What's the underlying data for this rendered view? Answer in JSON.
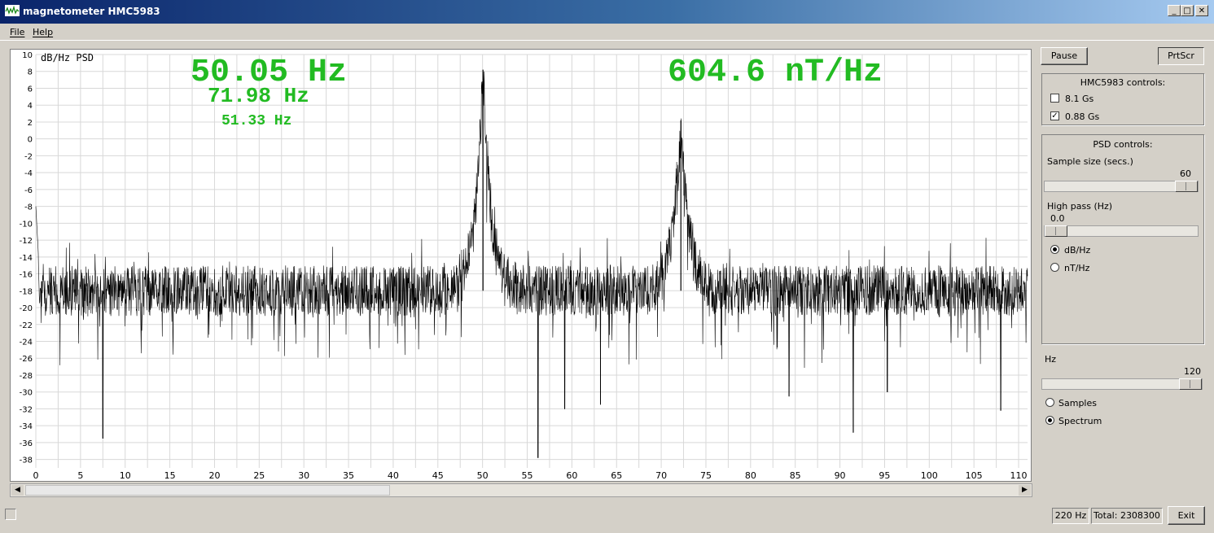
{
  "window": {
    "title": "magnetometer HMC5983",
    "min_glyph": "_",
    "max_glyph": "□",
    "close_glyph": "✕"
  },
  "menu": {
    "file": "File",
    "help": "Help"
  },
  "plot": {
    "ylabel": "dB/Hz  PSD",
    "main_freq": "50.05 Hz",
    "second_freq": "71.98 Hz",
    "third_freq": "51.33 Hz",
    "magnitude": "604.6 nT/Hz",
    "text_color": "#22bb22"
  },
  "chart_data": {
    "type": "line",
    "ylabel": "dB/Hz  PSD",
    "xlim": [
      0,
      111
    ],
    "ylim": [
      -39,
      10
    ],
    "x_ticks": [
      0,
      5,
      10,
      15,
      20,
      25,
      30,
      35,
      40,
      45,
      50,
      55,
      60,
      65,
      70,
      75,
      80,
      85,
      90,
      95,
      100,
      105,
      110
    ],
    "y_ticks": [
      10,
      8,
      6,
      4,
      2,
      0,
      -2,
      -4,
      -6,
      -8,
      -10,
      -12,
      -14,
      -16,
      -18,
      -20,
      -22,
      -24,
      -26,
      -28,
      -30,
      -32,
      -34,
      -36,
      -38
    ],
    "grid": true,
    "noise_floor_db": -18,
    "peaks": [
      {
        "freq_hz": 50.05,
        "db": 8.2
      },
      {
        "freq_hz": 72.2,
        "db": 2.2
      }
    ],
    "dips": [
      {
        "freq_hz": 7.5,
        "db": -35.5
      },
      {
        "freq_hz": 56.2,
        "db": -37.8
      },
      {
        "freq_hz": 91.5,
        "db": -34.8
      },
      {
        "freq_hz": 63.2,
        "db": -31.5
      },
      {
        "freq_hz": 108.0,
        "db": -32.2
      },
      {
        "freq_hz": 59.2,
        "db": -32.0
      },
      {
        "freq_hz": 84.3,
        "db": -30.5
      },
      {
        "freq_hz": 95.3,
        "db": -30.0
      }
    ]
  },
  "buttons": {
    "pause": "Pause",
    "prtscr": "PrtScr",
    "exit": "Exit"
  },
  "hmc_group": {
    "title": "HMC5983 controls:",
    "opt1": "8.1 Gs",
    "opt1_checked": false,
    "opt2": "0.88 Gs",
    "opt2_checked": true,
    "check_glyph": "✓"
  },
  "psd_group": {
    "title": "PSD controls:",
    "sample_label": "Sample size (secs.)",
    "sample_value": "60",
    "sample_fraction": 1.0,
    "highpass_label": "High pass (Hz)",
    "highpass_value": "0.0",
    "highpass_fraction": 0.0,
    "radio_dbhz": "dB/Hz",
    "radio_nthz": "nT/Hz",
    "selected": "dB/Hz"
  },
  "hz_control": {
    "label": "Hz",
    "value": "120",
    "fraction": 1.0
  },
  "view_radios": {
    "samples": "Samples",
    "spectrum": "Spectrum",
    "selected": "Spectrum"
  },
  "scroll": {
    "left_glyph": "◀",
    "right_glyph": "▶"
  },
  "statusbar": {
    "rate": "220 Hz",
    "total": "Total: 2308300"
  }
}
